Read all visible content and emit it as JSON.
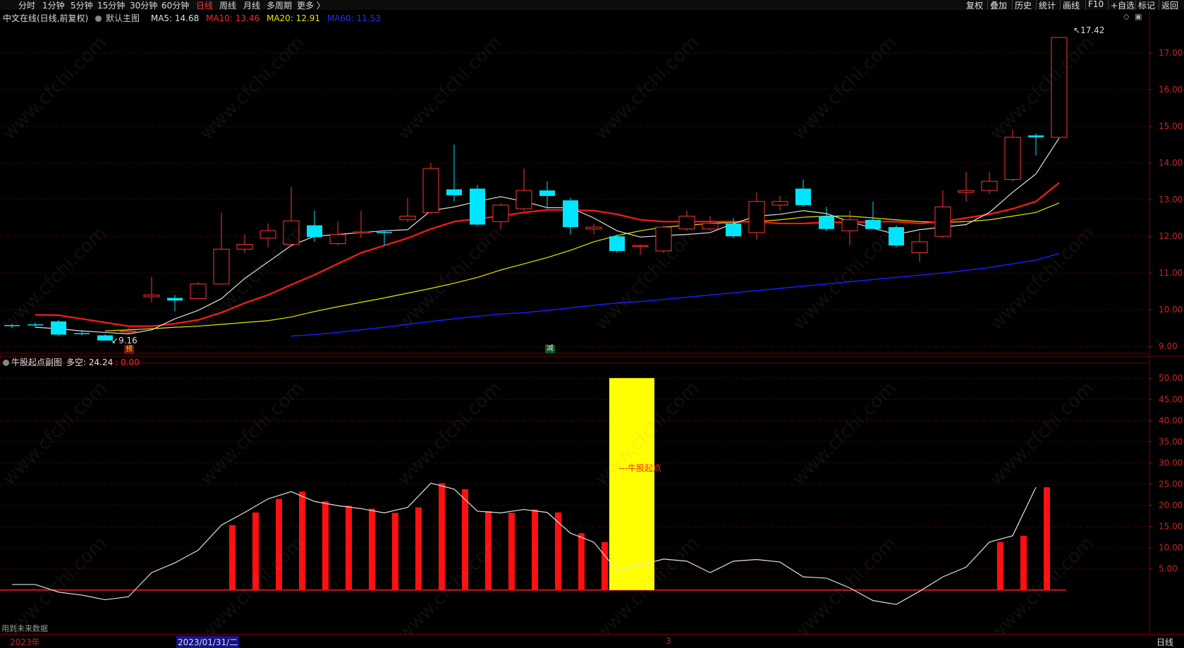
{
  "toolbar": {
    "periods": [
      "分时",
      "1分钟",
      "5分钟",
      "15分钟",
      "30分钟",
      "60分钟",
      "日线",
      "周线",
      "月线",
      "多周期",
      "更多 〉"
    ],
    "active_period": "日线",
    "right_buttons": [
      "复权",
      "叠加",
      "历史",
      "统计",
      "画线",
      "F10",
      "+自选",
      "标记",
      "返回"
    ]
  },
  "main_chart": {
    "title": "中文在线(日线,前复权)",
    "template_name": "默认主图",
    "ma5_label": "MA5: 14.68",
    "ma10_label": "MA10: 13.46",
    "ma20_label": "MA20: 12.91",
    "ma60_label": "MA60: 11.53",
    "high_label": "17.42",
    "low_label": "9.16",
    "marker_predict": "预",
    "marker_reduce": "减"
  },
  "sub_chart": {
    "title": "牛股起点副图",
    "duokong_label": "多空: 24.24",
    "extra_value": ": 0.00",
    "signal_label": "---牛股起点",
    "future_note": "用到未来数据"
  },
  "bottom_bar": {
    "year": "2023年",
    "cursor_date": "2023/01/31/二",
    "month_mark": "3",
    "period": "日线"
  },
  "watermark": "www.cfchi.com",
  "colors": {
    "up": "#ff3333",
    "down": "#00e5ff",
    "ma5": "#e0e0e0",
    "ma10": "#ff1a1a",
    "ma20": "#e6e600",
    "ma60": "#1a1aff",
    "signal": "#ffff00",
    "grid": "#7a0000"
  },
  "chart_data": [
    {
      "type": "candlestick",
      "title": "中文在线(日线,前复权)",
      "y_ticks": [
        9.0,
        10.0,
        11.0,
        12.0,
        13.0,
        14.0,
        15.0,
        16.0,
        17.0
      ],
      "ylim": [
        8.85,
        17.75
      ],
      "grid": true,
      "candles": [
        {
          "o": 9.58,
          "c": 9.56,
          "h": 9.62,
          "l": 9.5
        },
        {
          "o": 9.6,
          "c": 9.58,
          "h": 9.65,
          "l": 9.52
        },
        {
          "o": 9.68,
          "c": 9.32,
          "h": 9.72,
          "l": 9.28
        },
        {
          "o": 9.36,
          "c": 9.35,
          "h": 9.45,
          "l": 9.3
        },
        {
          "o": 9.3,
          "c": 9.16,
          "h": 9.33,
          "l": 9.16
        },
        {
          "o": 9.4,
          "c": 9.42,
          "h": 9.5,
          "l": 9.35
        },
        {
          "o": 10.35,
          "c": 10.4,
          "h": 10.9,
          "l": 10.2
        },
        {
          "o": 10.32,
          "c": 10.25,
          "h": 10.4,
          "l": 9.95
        },
        {
          "o": 10.3,
          "c": 10.7,
          "h": 10.75,
          "l": 10.28
        },
        {
          "o": 10.7,
          "c": 11.65,
          "h": 12.65,
          "l": 10.68
        },
        {
          "o": 11.65,
          "c": 11.78,
          "h": 12.05,
          "l": 11.55
        },
        {
          "o": 11.95,
          "c": 12.15,
          "h": 12.35,
          "l": 11.7
        },
        {
          "o": 11.78,
          "c": 12.42,
          "h": 13.35,
          "l": 11.75
        },
        {
          "o": 12.3,
          "c": 11.98,
          "h": 12.7,
          "l": 11.85
        },
        {
          "o": 11.8,
          "c": 12.05,
          "h": 12.4,
          "l": 11.75
        },
        {
          "o": 12.1,
          "c": 12.12,
          "h": 12.7,
          "l": 11.95
        },
        {
          "o": 12.12,
          "c": 12.1,
          "h": 12.15,
          "l": 11.75
        },
        {
          "o": 12.45,
          "c": 12.55,
          "h": 13.05,
          "l": 12.4
        },
        {
          "o": 12.65,
          "c": 13.85,
          "h": 14.0,
          "l": 12.6
        },
        {
          "o": 13.28,
          "c": 13.12,
          "h": 14.5,
          "l": 12.95
        },
        {
          "o": 13.3,
          "c": 12.32,
          "h": 13.4,
          "l": 12.3
        },
        {
          "o": 12.4,
          "c": 12.85,
          "h": 12.9,
          "l": 12.2
        },
        {
          "o": 12.75,
          "c": 13.25,
          "h": 13.85,
          "l": 12.7
        },
        {
          "o": 13.25,
          "c": 13.1,
          "h": 13.5,
          "l": 12.75
        },
        {
          "o": 12.98,
          "c": 12.25,
          "h": 13.05,
          "l": 12.05
        },
        {
          "o": 12.2,
          "c": 12.25,
          "h": 12.35,
          "l": 12.05
        },
        {
          "o": 12.0,
          "c": 11.6,
          "h": 12.05,
          "l": 11.55
        },
        {
          "o": 11.72,
          "c": 11.75,
          "h": 11.78,
          "l": 11.5
        },
        {
          "o": 11.6,
          "c": 12.25,
          "h": 12.3,
          "l": 11.55
        },
        {
          "o": 12.2,
          "c": 12.55,
          "h": 12.7,
          "l": 12.15
        },
        {
          "o": 12.2,
          "c": 12.35,
          "h": 12.55,
          "l": 12.15
        },
        {
          "o": 12.35,
          "c": 12.0,
          "h": 12.5,
          "l": 11.95
        },
        {
          "o": 12.1,
          "c": 12.95,
          "h": 13.2,
          "l": 11.9
        },
        {
          "o": 12.85,
          "c": 12.95,
          "h": 13.1,
          "l": 12.7
        },
        {
          "o": 13.3,
          "c": 12.85,
          "h": 13.55,
          "l": 12.8
        },
        {
          "o": 12.55,
          "c": 12.2,
          "h": 12.8,
          "l": 12.15
        },
        {
          "o": 12.15,
          "c": 12.45,
          "h": 12.7,
          "l": 11.75
        },
        {
          "o": 12.45,
          "c": 12.2,
          "h": 12.95,
          "l": 12.2
        },
        {
          "o": 12.25,
          "c": 11.75,
          "h": 12.3,
          "l": 11.7
        },
        {
          "o": 11.55,
          "c": 11.85,
          "h": 12.1,
          "l": 11.3
        },
        {
          "o": 12.0,
          "c": 12.8,
          "h": 13.25,
          "l": 11.95
        },
        {
          "o": 13.2,
          "c": 13.25,
          "h": 13.75,
          "l": 12.95
        },
        {
          "o": 13.25,
          "c": 13.5,
          "h": 13.75,
          "l": 13.15
        },
        {
          "o": 13.55,
          "c": 14.7,
          "h": 14.9,
          "l": 13.5
        },
        {
          "o": 14.75,
          "c": 14.7,
          "h": 14.8,
          "l": 14.2
        },
        {
          "o": 14.7,
          "c": 17.42,
          "h": 17.42,
          "l": 14.7
        }
      ],
      "ma5": [
        9.52,
        9.48,
        9.42,
        9.38,
        9.34,
        9.45,
        9.75,
        9.98,
        10.3,
        10.85,
        11.3,
        11.75,
        12.0,
        12.05,
        12.1,
        12.15,
        12.18,
        12.7,
        12.8,
        12.95,
        13.08,
        12.95,
        12.78,
        12.78,
        12.5,
        12.15,
        11.98,
        12.02,
        12.05,
        12.1,
        12.35,
        12.55,
        12.6,
        12.7,
        12.62,
        12.4,
        12.22,
        12.05,
        12.18,
        12.25,
        12.32,
        12.65,
        13.2,
        13.7,
        14.68
      ],
      "ma10": [
        9.86,
        9.85,
        9.75,
        9.65,
        9.55,
        9.55,
        9.62,
        9.72,
        9.92,
        10.18,
        10.4,
        10.68,
        10.95,
        11.25,
        11.55,
        11.75,
        11.95,
        12.2,
        12.4,
        12.48,
        12.55,
        12.65,
        12.72,
        12.72,
        12.7,
        12.6,
        12.45,
        12.4,
        12.4,
        12.4,
        12.4,
        12.4,
        12.35,
        12.35,
        12.38,
        12.38,
        12.4,
        12.4,
        12.35,
        12.4,
        12.5,
        12.6,
        12.75,
        12.95,
        13.46
      ],
      "ma20": [
        9.42,
        9.45,
        9.48,
        9.52,
        9.55,
        9.6,
        9.65,
        9.7,
        9.8,
        9.95,
        10.08,
        10.2,
        10.32,
        10.45,
        10.58,
        10.72,
        10.88,
        11.08,
        11.25,
        11.42,
        11.62,
        11.85,
        12.02,
        12.15,
        12.25,
        12.3,
        12.35,
        12.38,
        12.4,
        12.45,
        12.52,
        12.55,
        12.55,
        12.5,
        12.45,
        12.4,
        12.38,
        12.4,
        12.45,
        12.55,
        12.65,
        12.91
      ],
      "ma60": [
        9.28,
        9.32,
        9.38,
        9.45,
        9.52,
        9.6,
        9.68,
        9.75,
        9.82,
        9.88,
        9.92,
        9.98,
        10.05,
        10.12,
        10.18,
        10.22,
        10.28,
        10.34,
        10.4,
        10.46,
        10.52,
        10.58,
        10.64,
        10.7,
        10.76,
        10.82,
        10.88,
        10.94,
        11.0,
        11.07,
        11.15,
        11.25,
        11.35,
        11.53
      ]
    },
    {
      "type": "bar",
      "title": "牛股起点副图",
      "y_ticks": [
        5,
        10,
        15,
        20,
        25,
        30,
        35,
        40,
        45,
        50
      ],
      "ylim": [
        -5.2,
        52.2
      ],
      "grid": true,
      "line": [
        1.3,
        1.3,
        -0.5,
        -1.2,
        -2.3,
        -1.6,
        4.1,
        6.4,
        9.4,
        15.3,
        18.3,
        21.5,
        23.2,
        20.9,
        19.9,
        19.2,
        18.2,
        19.5,
        25.2,
        23.8,
        18.6,
        18.2,
        19.0,
        18.3,
        13.4,
        11.3,
        4.6,
        5.9,
        7.3,
        6.8,
        4.1,
        6.8,
        7.2,
        6.6,
        3.1,
        2.8,
        0.5,
        -2.5,
        -3.4,
        -0.3,
        3.1,
        5.4,
        11.3,
        12.8,
        24.24
      ],
      "bars": [
        0,
        0,
        0,
        0,
        0,
        0,
        0,
        0,
        0,
        15.3,
        18.3,
        21.5,
        23.2,
        20.9,
        19.9,
        19.2,
        18.2,
        19.5,
        25.2,
        23.8,
        18.6,
        18.2,
        19.0,
        18.3,
        13.4,
        11.3,
        0,
        0,
        0,
        0,
        0,
        0,
        0,
        0,
        0,
        0,
        0,
        0,
        0,
        0,
        0,
        0,
        11.3,
        12.8,
        24.24
      ],
      "signal_bar": {
        "index": 26,
        "value": 50
      }
    }
  ]
}
